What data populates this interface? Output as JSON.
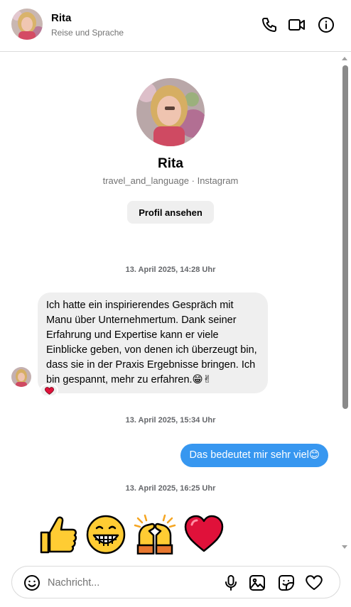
{
  "header": {
    "name": "Rita",
    "subtitle": "Reise und Sprache",
    "icons": [
      "phone-icon",
      "video-call-icon",
      "info-icon"
    ]
  },
  "profile": {
    "name": "Rita",
    "subtitle": "travel_and_language · Instagram",
    "button_label": "Profil ansehen"
  },
  "messages": [
    {
      "timestamp": "13. April 2025, 14:28 Uhr",
      "direction": "incoming",
      "text": "Ich hatte ein inspirierendes Gespräch mit Manu über Unternehmertum. Dank seiner Erfahrung und Expertise kann er viele Einblicke geben, von denen ich überzeugt bin, dass sie in der Praxis Ergebnisse bringen. Ich bin gespannt, mehr zu erfahren.😁✌",
      "reaction": "❤"
    },
    {
      "timestamp": "13. April 2025, 15:34 Uhr",
      "direction": "outgoing",
      "text": "Das bedeutet mir sehr viel😊"
    },
    {
      "timestamp": "13. April 2025, 16:25 Uhr",
      "direction": "incoming",
      "emojis": [
        "thumbs-up",
        "grinning-face",
        "raising-hands",
        "red-heart"
      ]
    }
  ],
  "composer": {
    "placeholder": "Nachricht...",
    "icons": [
      "emoji-icon",
      "microphone-icon",
      "image-icon",
      "sticker-icon",
      "heart-icon"
    ]
  },
  "colors": {
    "outgoing_bubble": "#3797f0",
    "incoming_bubble": "#efefef",
    "divider": "#dbdbdb",
    "secondary_text": "#737373"
  }
}
